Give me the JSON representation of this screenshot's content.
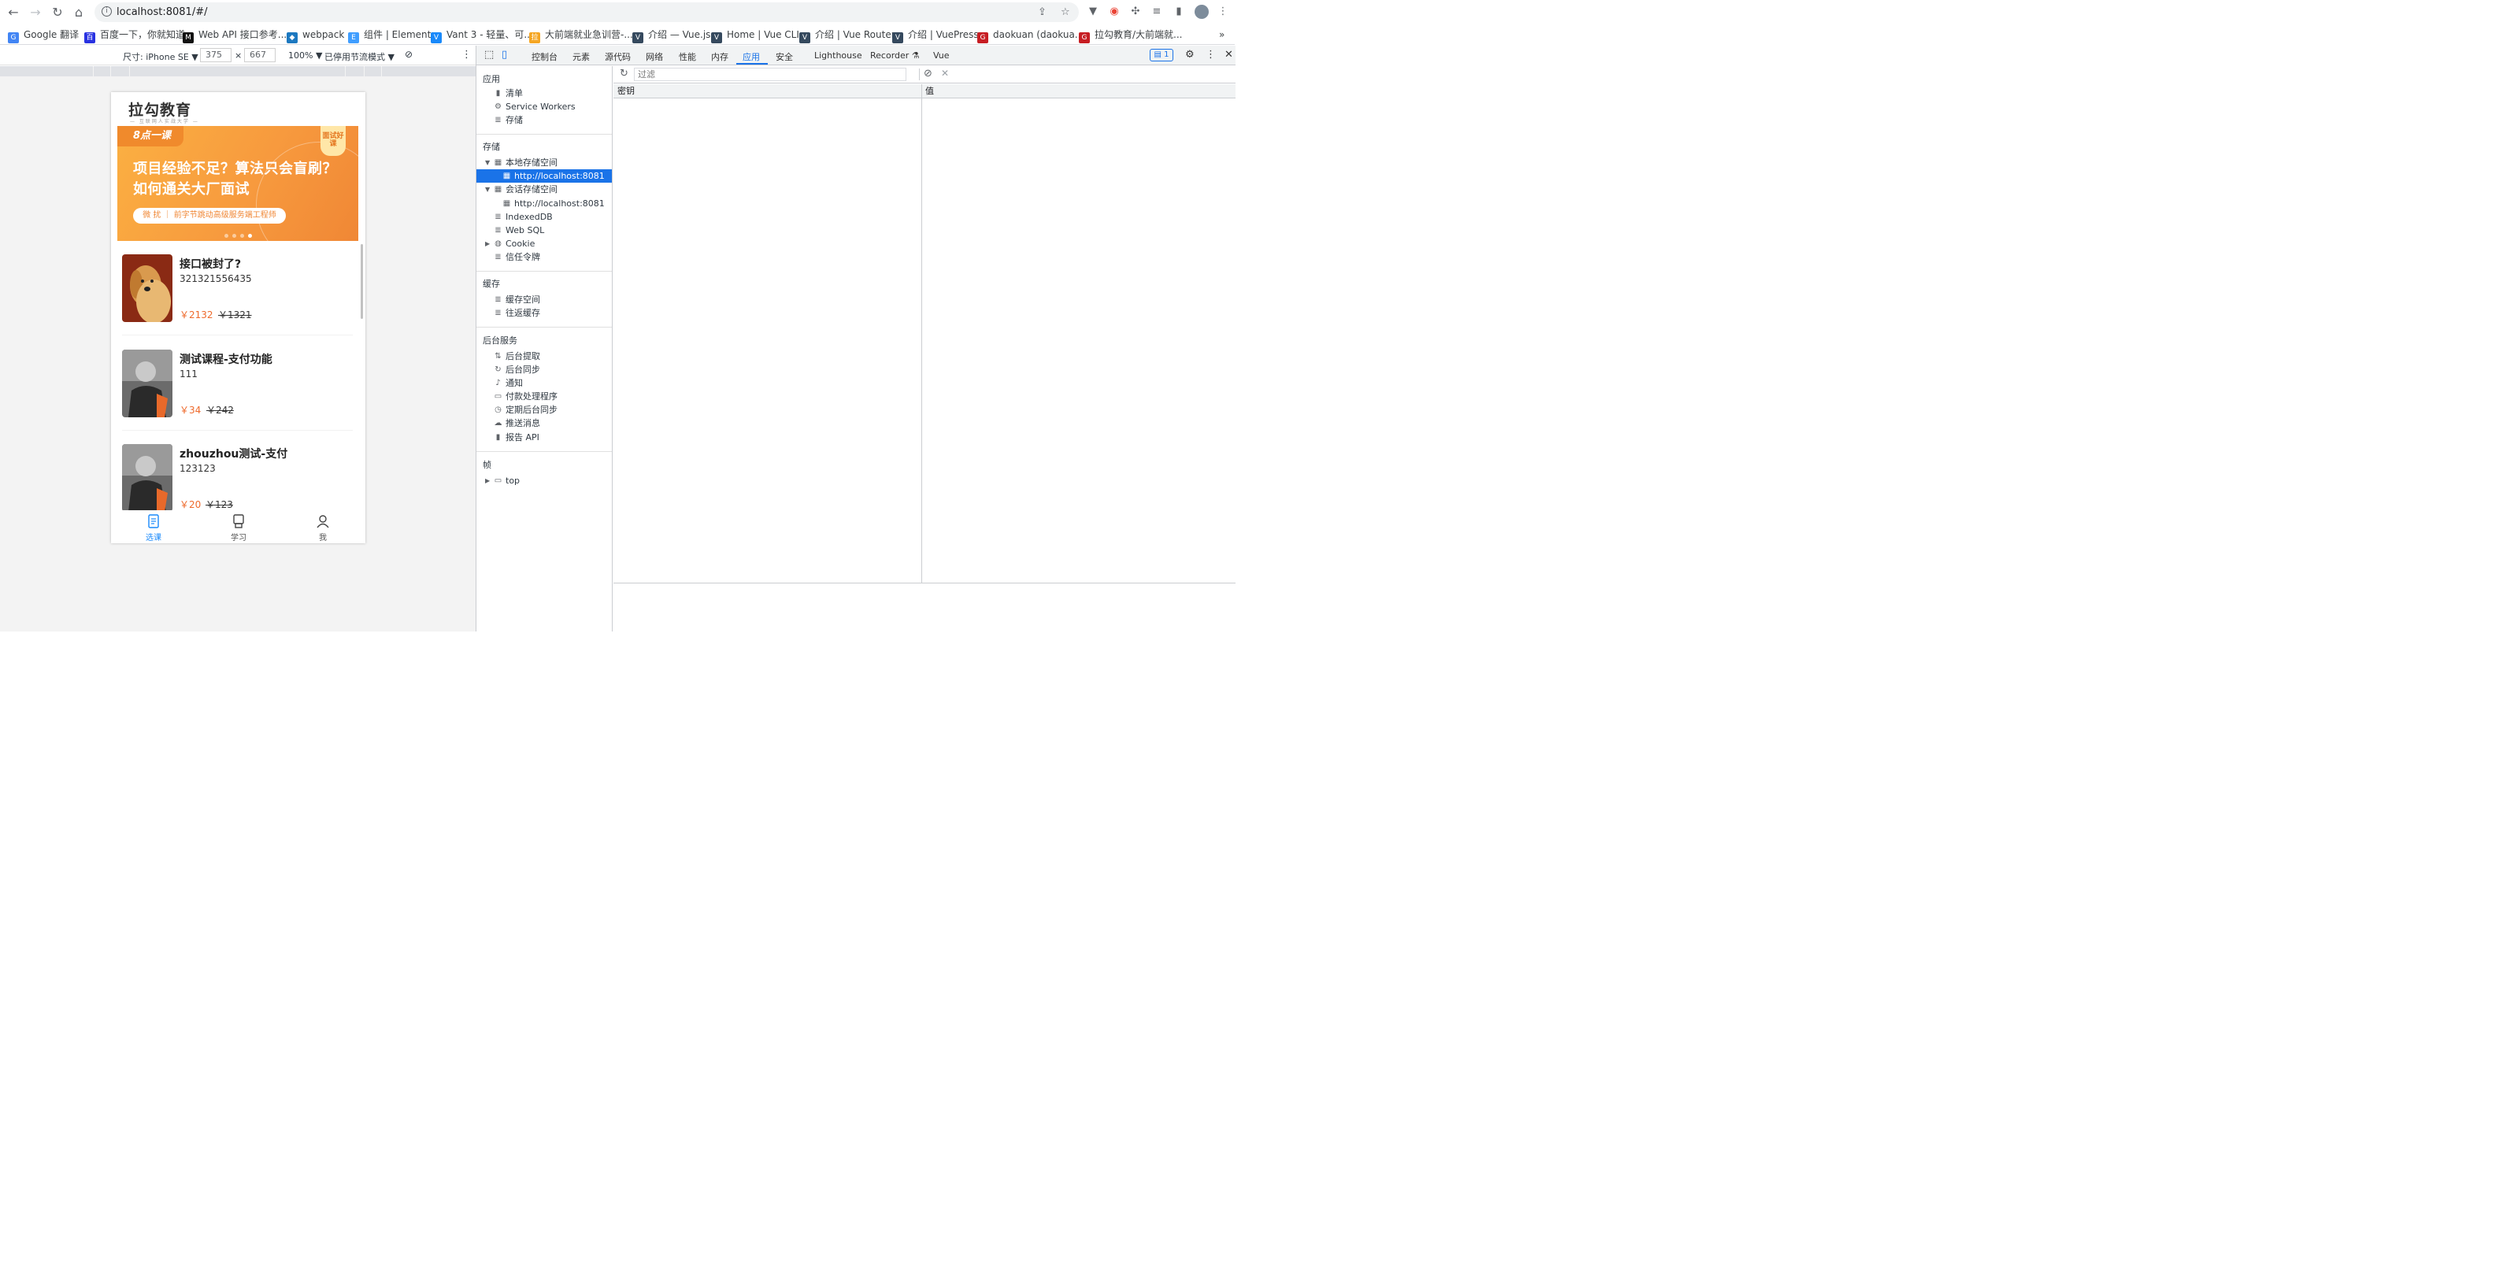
{
  "browser": {
    "url": "localhost:8081/#/",
    "bookmarks": [
      {
        "label": "Google 翻译",
        "color": "#4285f4",
        "glyph": "G"
      },
      {
        "label": "百度一下，你就知道",
        "color": "#2932e1",
        "glyph": "百"
      },
      {
        "label": "Web API 接口参考...",
        "color": "#111111",
        "glyph": "M"
      },
      {
        "label": "webpack",
        "color": "#1c78c0",
        "glyph": "◆"
      },
      {
        "label": "组件 | Element",
        "color": "#409eff",
        "glyph": "E"
      },
      {
        "label": "Vant 3 - 轻量、可...",
        "color": "#1989fa",
        "glyph": "V"
      },
      {
        "label": "大前端就业急训营-...",
        "color": "#f5a623",
        "glyph": "拉"
      },
      {
        "label": "介绍 — Vue.js",
        "color": "#35495e",
        "glyph": "V"
      },
      {
        "label": "Home | Vue CLI",
        "color": "#35495e",
        "glyph": "V"
      },
      {
        "label": "介绍 | Vue Router",
        "color": "#35495e",
        "glyph": "V"
      },
      {
        "label": "介绍 | VuePress",
        "color": "#35495e",
        "glyph": "V"
      },
      {
        "label": "daokuan (daokua...",
        "color": "#c71d23",
        "glyph": "G"
      },
      {
        "label": "拉勾教育/大前端就...",
        "color": "#c71d23",
        "glyph": "G"
      }
    ],
    "more_bookmarks": "»"
  },
  "device_toolbar": {
    "size_label": "尺寸: iPhone SE ▼",
    "width": "375",
    "times": "×",
    "height": "667",
    "zoom": "100% ▼",
    "throttle": "已停用节流模式 ▼"
  },
  "app": {
    "logo": "拉勾教育",
    "logo_sub": "— 互联网人实战大学 —",
    "banner": {
      "tag": "8点一课",
      "corner": "面试好课",
      "headline_1": "项目经验不足？算法只会盲刷？",
      "headline_2": "如何通关大厂面试",
      "pill": "微 扰 ｜ 前字节跳动高级服务端工程师"
    },
    "courses": [
      {
        "title": "接口被封了?",
        "desc": "321321556435",
        "price": "￥2132",
        "old_price": "￥1321"
      },
      {
        "title": "测试课程-支付功能",
        "desc": "111",
        "price": "￥34",
        "old_price": "￥242"
      },
      {
        "title": "zhouzhou测试-支付",
        "desc": "123123",
        "price": "￥20",
        "old_price": "￥123"
      }
    ],
    "tabs": [
      {
        "label": "选课"
      },
      {
        "label": "学习"
      },
      {
        "label": "我"
      }
    ]
  },
  "devtools": {
    "tabs": [
      "控制台",
      "元素",
      "源代码",
      "网络",
      "性能",
      "内存",
      "应用",
      "安全",
      "Lighthouse",
      "Recorder ⚗",
      "Vue"
    ],
    "active_tab": "应用",
    "message_count": "1",
    "sidebar": {
      "app_section": "应用",
      "app_items": [
        "清单",
        "Service Workers",
        "存储"
      ],
      "storage_section": "存储",
      "local_storage": "本地存储空间",
      "local_storage_origin": "http://localhost:8081",
      "session_storage": "会话存储空间",
      "session_storage_origin": "http://localhost:8081",
      "storage_items": [
        "IndexedDB",
        "Web SQL",
        "Cookie",
        "信任令牌"
      ],
      "cache_section": "缓存",
      "cache_items": [
        "缓存空间",
        "往返缓存"
      ],
      "bg_section": "后台服务",
      "bg_items": [
        "后台提取",
        "后台同步",
        "通知",
        "付款处理程序",
        "定期后台同步",
        "推送消息",
        "报告 API"
      ],
      "frames_section": "帧",
      "frames_top": "top"
    },
    "filter_placeholder": "过滤",
    "table": {
      "key_header": "密钥",
      "value_header": "值"
    }
  }
}
